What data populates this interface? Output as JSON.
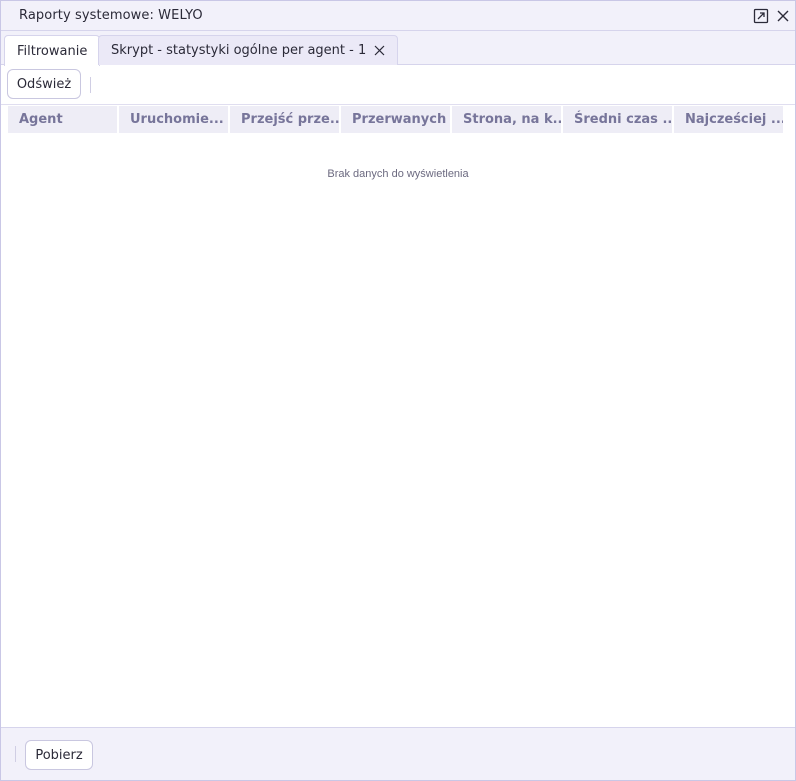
{
  "window": {
    "title": "Raporty systemowe: WELYO",
    "icons": [
      "popout-icon",
      "close-icon"
    ]
  },
  "tabs": [
    {
      "label": "Filtrowanie",
      "active": true,
      "closable": false
    },
    {
      "label": "Skrypt - statystyki ogólne per agent - 1",
      "active": false,
      "closable": true
    }
  ],
  "toolbar": {
    "refresh_label": "Odśwież"
  },
  "grid": {
    "columns": [
      "Agent",
      "Uruchomie...",
      "Przejść prze...",
      "Przerwanych",
      "Strona, na k...",
      "Średni czas ...",
      "Najcześciej ..."
    ],
    "empty_message": "Brak danych do wyświetlenia"
  },
  "footer": {
    "download_label": "Pobierz"
  },
  "colors": {
    "chrome_bg": "#f2f1fa",
    "border": "#c9c7e6",
    "header_text": "#77759a",
    "header_bg": "#eeedf6"
  }
}
